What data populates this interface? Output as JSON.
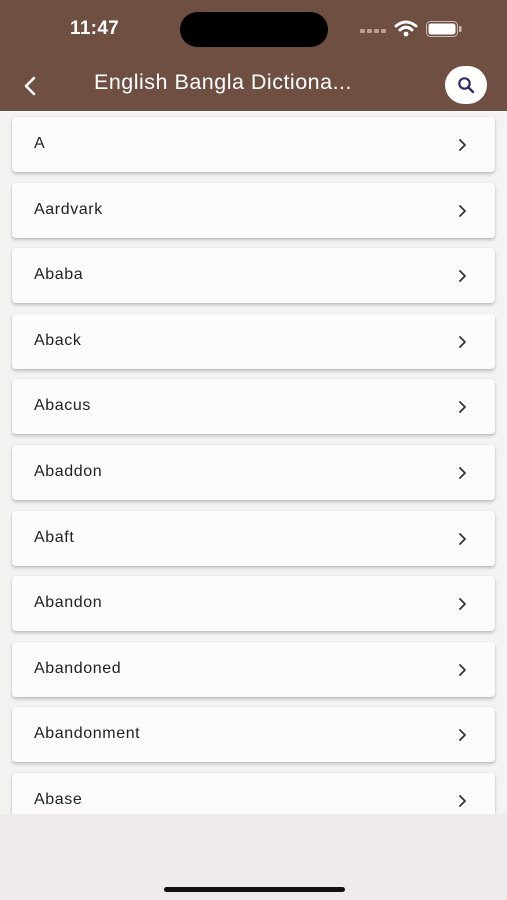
{
  "status_bar": {
    "time": "11:47"
  },
  "header": {
    "title": "English Bangla Dictiona..."
  },
  "icons": {
    "back": "back-chevron-icon",
    "search": "search-icon",
    "row_chevron": "chevron-right-icon"
  },
  "colors": {
    "header": "#6e4f42",
    "background": "#efebea",
    "row": "#fdfbfc",
    "search_icon": "#2f2b6e"
  },
  "words": [
    {
      "label": "A"
    },
    {
      "label": "Aardvark"
    },
    {
      "label": "Ababa"
    },
    {
      "label": "Aback"
    },
    {
      "label": "Abacus"
    },
    {
      "label": "Abaddon"
    },
    {
      "label": "Abaft"
    },
    {
      "label": "Abandon"
    },
    {
      "label": "Abandoned"
    },
    {
      "label": "Abandonment"
    },
    {
      "label": "Abase"
    }
  ]
}
